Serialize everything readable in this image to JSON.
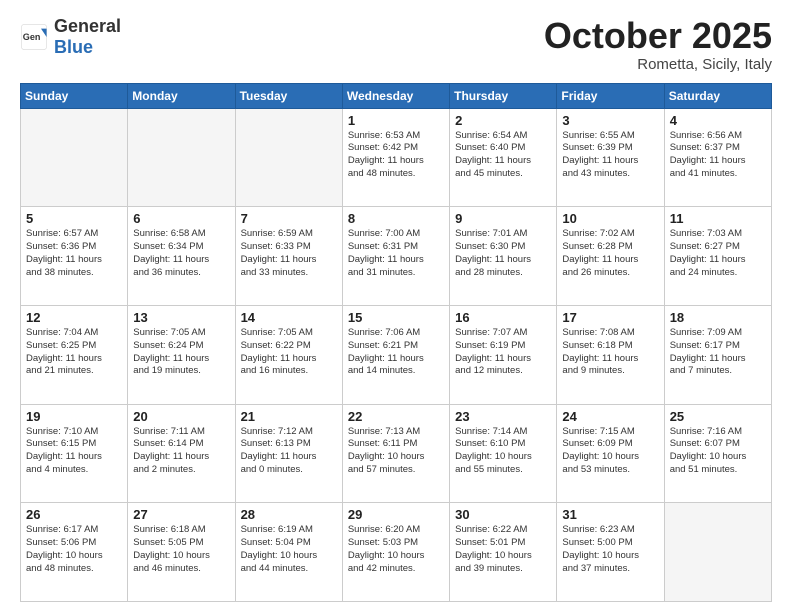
{
  "header": {
    "logo": {
      "general": "General",
      "blue": "Blue"
    },
    "month": "October 2025",
    "location": "Rometta, Sicily, Italy"
  },
  "weekdays": [
    "Sunday",
    "Monday",
    "Tuesday",
    "Wednesday",
    "Thursday",
    "Friday",
    "Saturday"
  ],
  "weeks": [
    [
      {
        "day": "",
        "empty": true,
        "text": ""
      },
      {
        "day": "",
        "empty": true,
        "text": ""
      },
      {
        "day": "",
        "empty": true,
        "text": ""
      },
      {
        "day": "1",
        "empty": false,
        "text": "Sunrise: 6:53 AM\nSunset: 6:42 PM\nDaylight: 11 hours\nand 48 minutes."
      },
      {
        "day": "2",
        "empty": false,
        "text": "Sunrise: 6:54 AM\nSunset: 6:40 PM\nDaylight: 11 hours\nand 45 minutes."
      },
      {
        "day": "3",
        "empty": false,
        "text": "Sunrise: 6:55 AM\nSunset: 6:39 PM\nDaylight: 11 hours\nand 43 minutes."
      },
      {
        "day": "4",
        "empty": false,
        "text": "Sunrise: 6:56 AM\nSunset: 6:37 PM\nDaylight: 11 hours\nand 41 minutes."
      }
    ],
    [
      {
        "day": "5",
        "empty": false,
        "text": "Sunrise: 6:57 AM\nSunset: 6:36 PM\nDaylight: 11 hours\nand 38 minutes."
      },
      {
        "day": "6",
        "empty": false,
        "text": "Sunrise: 6:58 AM\nSunset: 6:34 PM\nDaylight: 11 hours\nand 36 minutes."
      },
      {
        "day": "7",
        "empty": false,
        "text": "Sunrise: 6:59 AM\nSunset: 6:33 PM\nDaylight: 11 hours\nand 33 minutes."
      },
      {
        "day": "8",
        "empty": false,
        "text": "Sunrise: 7:00 AM\nSunset: 6:31 PM\nDaylight: 11 hours\nand 31 minutes."
      },
      {
        "day": "9",
        "empty": false,
        "text": "Sunrise: 7:01 AM\nSunset: 6:30 PM\nDaylight: 11 hours\nand 28 minutes."
      },
      {
        "day": "10",
        "empty": false,
        "text": "Sunrise: 7:02 AM\nSunset: 6:28 PM\nDaylight: 11 hours\nand 26 minutes."
      },
      {
        "day": "11",
        "empty": false,
        "text": "Sunrise: 7:03 AM\nSunset: 6:27 PM\nDaylight: 11 hours\nand 24 minutes."
      }
    ],
    [
      {
        "day": "12",
        "empty": false,
        "text": "Sunrise: 7:04 AM\nSunset: 6:25 PM\nDaylight: 11 hours\nand 21 minutes."
      },
      {
        "day": "13",
        "empty": false,
        "text": "Sunrise: 7:05 AM\nSunset: 6:24 PM\nDaylight: 11 hours\nand 19 minutes."
      },
      {
        "day": "14",
        "empty": false,
        "text": "Sunrise: 7:05 AM\nSunset: 6:22 PM\nDaylight: 11 hours\nand 16 minutes."
      },
      {
        "day": "15",
        "empty": false,
        "text": "Sunrise: 7:06 AM\nSunset: 6:21 PM\nDaylight: 11 hours\nand 14 minutes."
      },
      {
        "day": "16",
        "empty": false,
        "text": "Sunrise: 7:07 AM\nSunset: 6:19 PM\nDaylight: 11 hours\nand 12 minutes."
      },
      {
        "day": "17",
        "empty": false,
        "text": "Sunrise: 7:08 AM\nSunset: 6:18 PM\nDaylight: 11 hours\nand 9 minutes."
      },
      {
        "day": "18",
        "empty": false,
        "text": "Sunrise: 7:09 AM\nSunset: 6:17 PM\nDaylight: 11 hours\nand 7 minutes."
      }
    ],
    [
      {
        "day": "19",
        "empty": false,
        "text": "Sunrise: 7:10 AM\nSunset: 6:15 PM\nDaylight: 11 hours\nand 4 minutes."
      },
      {
        "day": "20",
        "empty": false,
        "text": "Sunrise: 7:11 AM\nSunset: 6:14 PM\nDaylight: 11 hours\nand 2 minutes."
      },
      {
        "day": "21",
        "empty": false,
        "text": "Sunrise: 7:12 AM\nSunset: 6:13 PM\nDaylight: 11 hours\nand 0 minutes."
      },
      {
        "day": "22",
        "empty": false,
        "text": "Sunrise: 7:13 AM\nSunset: 6:11 PM\nDaylight: 10 hours\nand 57 minutes."
      },
      {
        "day": "23",
        "empty": false,
        "text": "Sunrise: 7:14 AM\nSunset: 6:10 PM\nDaylight: 10 hours\nand 55 minutes."
      },
      {
        "day": "24",
        "empty": false,
        "text": "Sunrise: 7:15 AM\nSunset: 6:09 PM\nDaylight: 10 hours\nand 53 minutes."
      },
      {
        "day": "25",
        "empty": false,
        "text": "Sunrise: 7:16 AM\nSunset: 6:07 PM\nDaylight: 10 hours\nand 51 minutes."
      }
    ],
    [
      {
        "day": "26",
        "empty": false,
        "text": "Sunrise: 6:17 AM\nSunset: 5:06 PM\nDaylight: 10 hours\nand 48 minutes."
      },
      {
        "day": "27",
        "empty": false,
        "text": "Sunrise: 6:18 AM\nSunset: 5:05 PM\nDaylight: 10 hours\nand 46 minutes."
      },
      {
        "day": "28",
        "empty": false,
        "text": "Sunrise: 6:19 AM\nSunset: 5:04 PM\nDaylight: 10 hours\nand 44 minutes."
      },
      {
        "day": "29",
        "empty": false,
        "text": "Sunrise: 6:20 AM\nSunset: 5:03 PM\nDaylight: 10 hours\nand 42 minutes."
      },
      {
        "day": "30",
        "empty": false,
        "text": "Sunrise: 6:22 AM\nSunset: 5:01 PM\nDaylight: 10 hours\nand 39 minutes."
      },
      {
        "day": "31",
        "empty": false,
        "text": "Sunrise: 6:23 AM\nSunset: 5:00 PM\nDaylight: 10 hours\nand 37 minutes."
      },
      {
        "day": "",
        "empty": true,
        "text": ""
      }
    ]
  ]
}
